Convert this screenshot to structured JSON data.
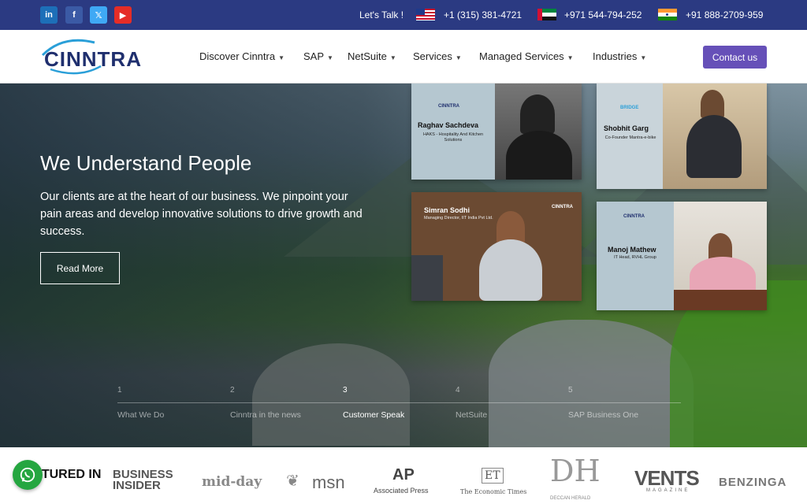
{
  "topbar": {
    "social": [
      "in",
      "f",
      "𝕏",
      "▶"
    ],
    "talk_label": "Let's Talk !",
    "phones": [
      {
        "flag": "us-flag",
        "number": "+1 (315) 381-4721"
      },
      {
        "flag": "uae-flag",
        "number": "+971 544-794-252"
      },
      {
        "flag": "india-flag",
        "number": "+91 888-2709-959"
      }
    ]
  },
  "brand": {
    "logo_text": "CINNTRA"
  },
  "nav": {
    "items": [
      "Discover Cinntra",
      "SAP",
      "NetSuite",
      "Services",
      "Managed Services",
      "Industries"
    ],
    "cta": "Contact us"
  },
  "hero": {
    "title": "We Understand People",
    "text": "Our clients are at the heart of our business. We pinpoint your pain areas and develop innovative solutions to drive growth and success.",
    "read_more": "Read More"
  },
  "testimonials": [
    {
      "brand": "CINNTRA",
      "name": "Raghav Sachdeva",
      "role": "HAKS - Hospitality And Kitchen Solutions"
    },
    {
      "brand": "BRIDGE",
      "name": "Shobhit Garg",
      "role": "Co-Founder Mantra-e-bike"
    },
    {
      "brand": "CINNTRA",
      "name": "Simran Sodhi",
      "role": "Managing Director, IIT India Pvt Ltd."
    },
    {
      "brand": "CINNTRA",
      "name": "Manoj Mathew",
      "role": "IT Head, RVHL Group"
    }
  ],
  "slider": {
    "active_index": 2,
    "items": [
      {
        "num": "1",
        "label": "What We Do"
      },
      {
        "num": "2",
        "label": "Cinntra in the news"
      },
      {
        "num": "3",
        "label": "Customer Speak"
      },
      {
        "num": "4",
        "label": "NetSuite"
      },
      {
        "num": "5",
        "label": "SAP Business One"
      }
    ]
  },
  "featured": {
    "label": "FEATURED IN",
    "logos": [
      "BUSINESS INSIDER",
      "mid-day",
      "msn",
      "AP",
      "Associated Press",
      "ET",
      "The Economic Times",
      "DH",
      "DECCAN HERALD",
      "VENTS",
      "MAGAZINE",
      "BENZINGA"
    ]
  },
  "colors": {
    "topbar": "#2b3a82",
    "cta": "#6650b8",
    "whatsapp": "#25a640"
  }
}
